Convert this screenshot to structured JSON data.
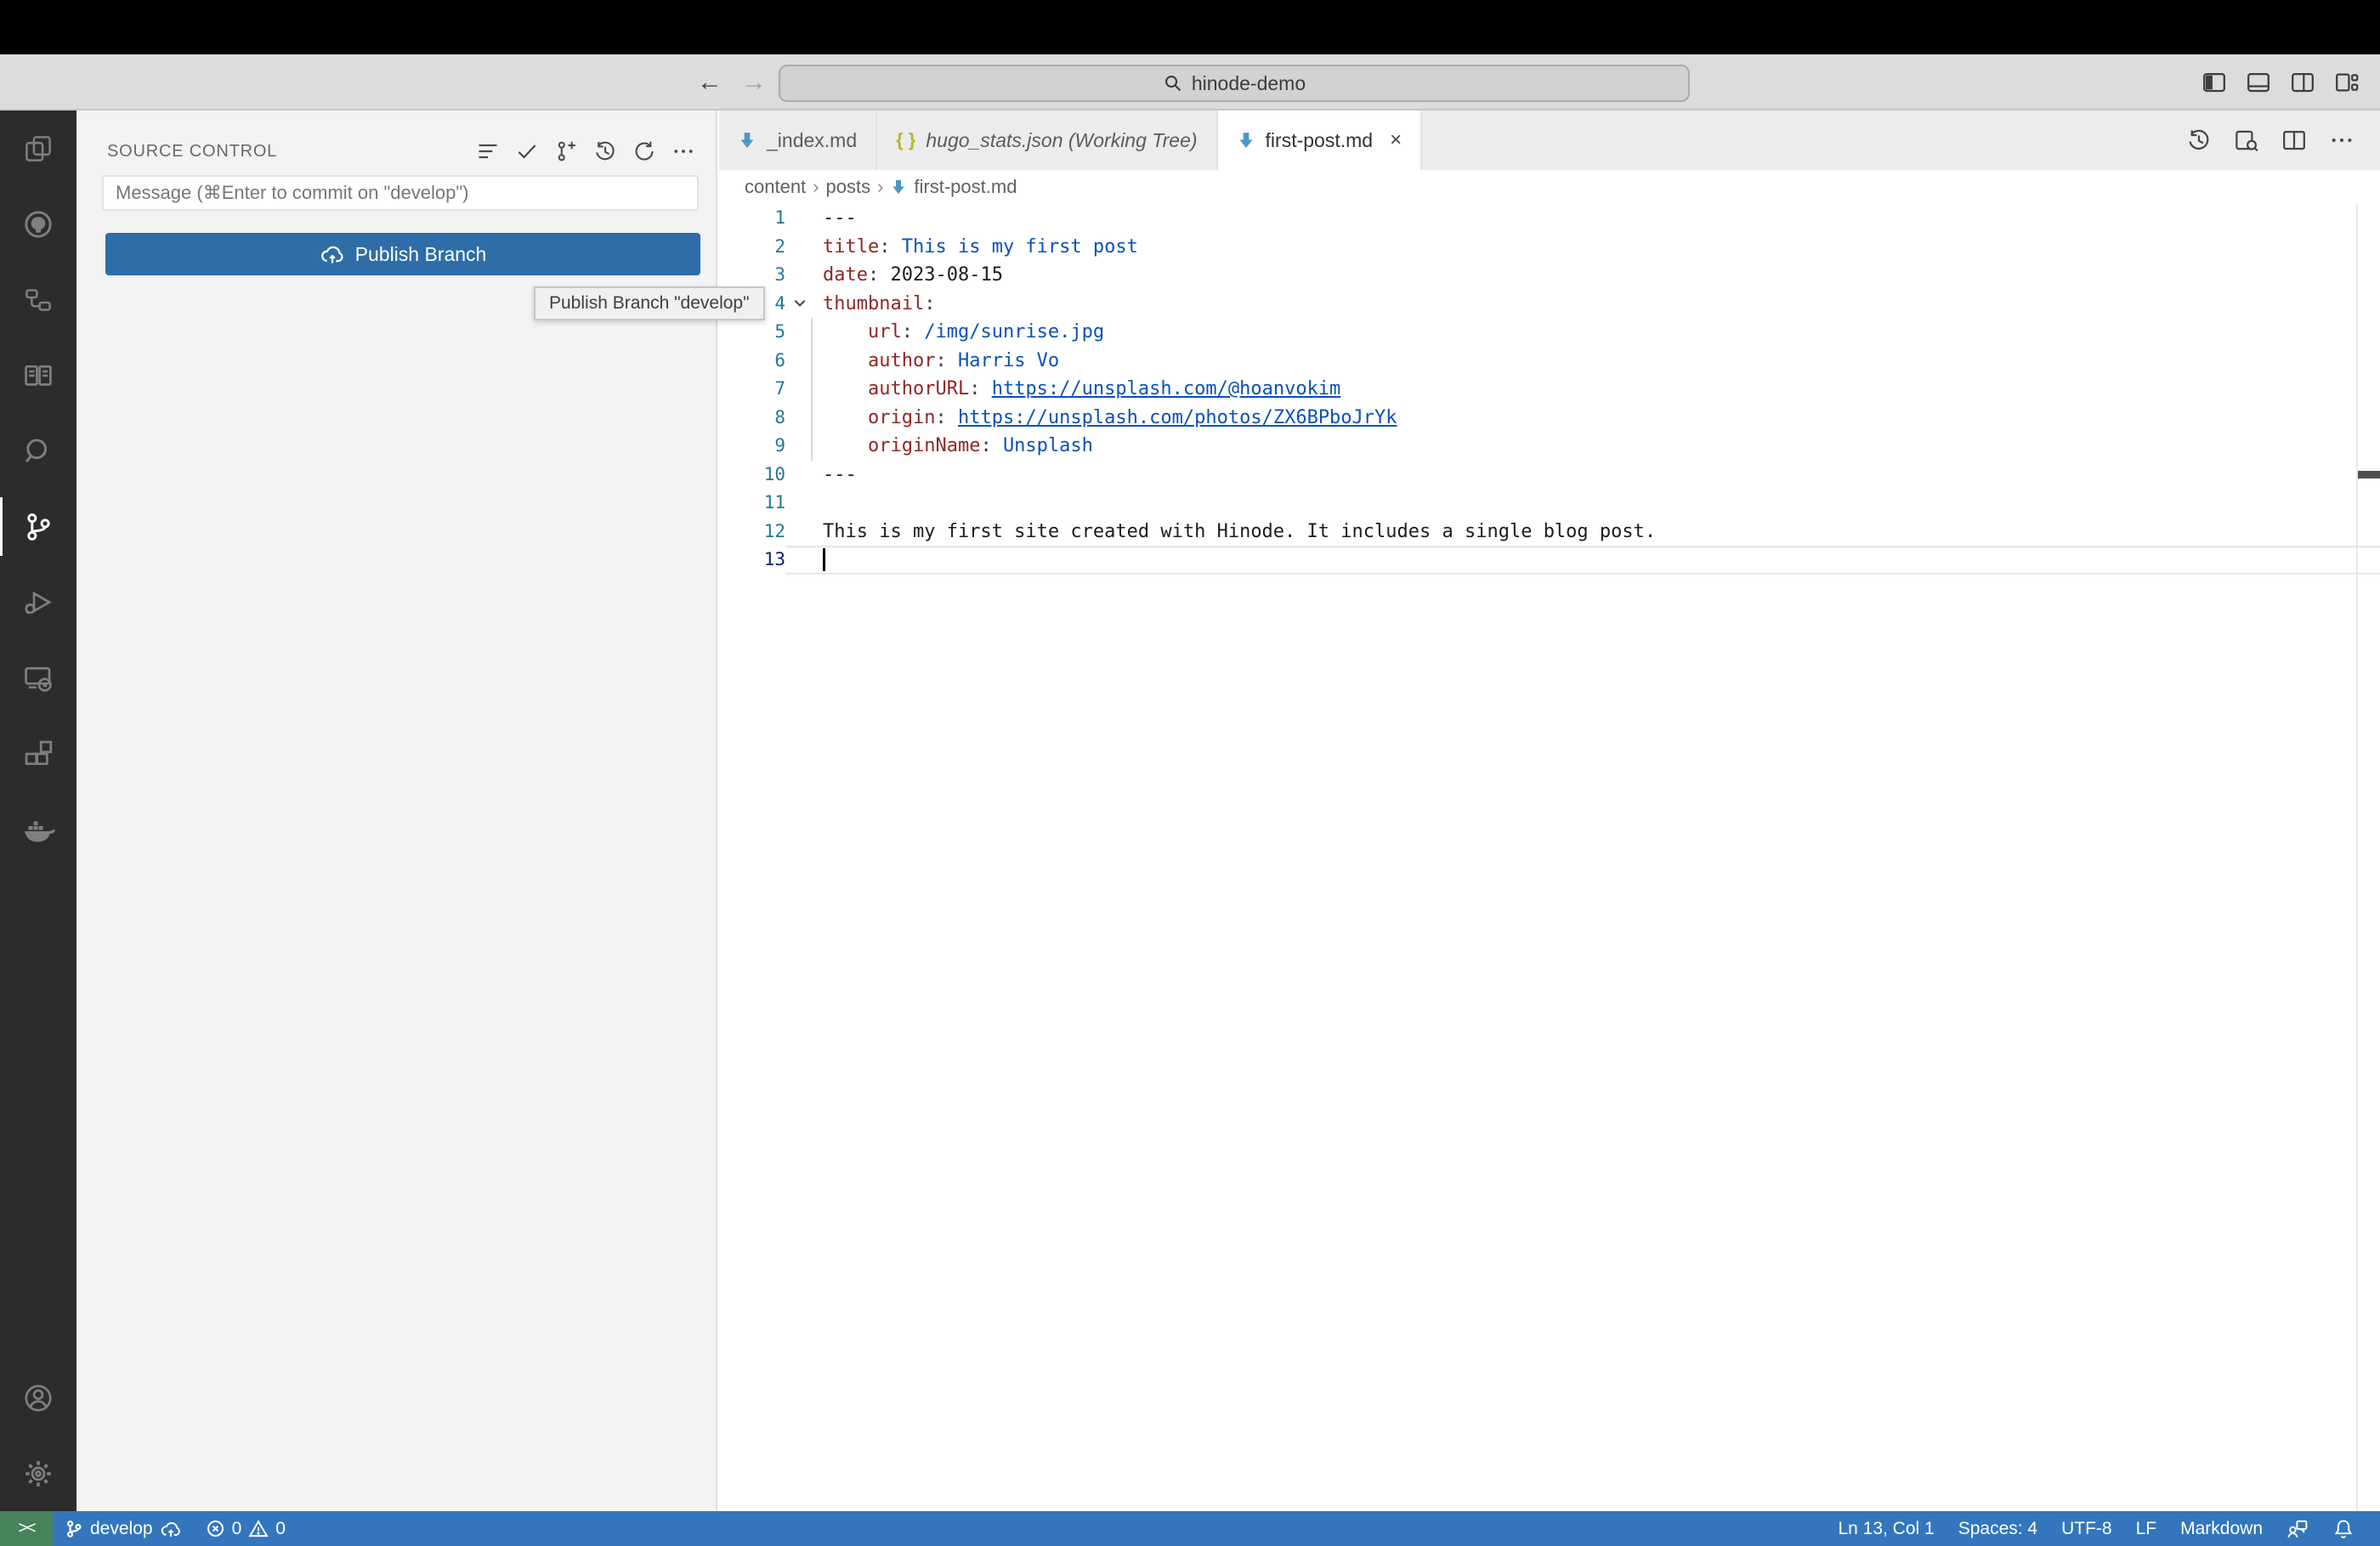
{
  "titlebar": {
    "search_value": "hinode-demo",
    "back": "←",
    "forward": "→",
    "icons": [
      "layout-sidebar-left",
      "layout-panel",
      "layout-sidebar-right",
      "layout-customize"
    ]
  },
  "activity_bar": {
    "items": [
      "explorer",
      "github",
      "hierarchy",
      "book",
      "search",
      "source-control",
      "run-debug",
      "remote-explorer",
      "extensions",
      "docker"
    ],
    "active": "source-control",
    "bottom": [
      "account",
      "settings"
    ]
  },
  "sidebar": {
    "title": "SOURCE CONTROL",
    "actions": [
      "view-as-list",
      "commit-check",
      "branch-create",
      "history",
      "refresh",
      "more-actions"
    ],
    "message_placeholder": "Message (⌘Enter to commit on \"develop\")",
    "publish_label": "Publish Branch",
    "tooltip": "Publish Branch \"develop\""
  },
  "editor": {
    "tabs": [
      {
        "label": "_index.md",
        "icon": "markdown"
      },
      {
        "label": "hugo_stats.json (Working Tree)",
        "icon": "json"
      },
      {
        "label": "first-post.md",
        "icon": "markdown",
        "close": "×"
      }
    ],
    "actions": [
      "timeline",
      "open-preview",
      "split-editor",
      "more-actions"
    ],
    "breadcrumb": {
      "items": [
        "content",
        "posts"
      ],
      "separator": "›",
      "file": "first-post.md"
    },
    "lines": [
      {
        "n": "1",
        "tokens": [
          [
            "---",
            "pln"
          ]
        ]
      },
      {
        "n": "2",
        "tokens": [
          [
            "title",
            "key"
          ],
          [
            ": ",
            "pun"
          ],
          [
            "This is my first post",
            "str"
          ]
        ]
      },
      {
        "n": "3",
        "tokens": [
          [
            "date",
            "key"
          ],
          [
            ": ",
            "pun"
          ],
          [
            "2023-08-15",
            "pln"
          ]
        ]
      },
      {
        "n": "4",
        "fold": true,
        "tokens": [
          [
            "thumbnail",
            "key"
          ],
          [
            ":",
            "pun"
          ]
        ]
      },
      {
        "n": "5",
        "guide": true,
        "tokens": [
          [
            "    ",
            "pln"
          ],
          [
            "url",
            "key"
          ],
          [
            ": ",
            "pun"
          ],
          [
            "/img/sunrise.jpg",
            "str"
          ]
        ]
      },
      {
        "n": "6",
        "guide": true,
        "tokens": [
          [
            "    ",
            "pln"
          ],
          [
            "author",
            "key"
          ],
          [
            ": ",
            "pun"
          ],
          [
            "Harris Vo",
            "str"
          ]
        ]
      },
      {
        "n": "7",
        "guide": true,
        "tokens": [
          [
            "    ",
            "pln"
          ],
          [
            "authorURL",
            "key"
          ],
          [
            ": ",
            "pun"
          ],
          [
            "https://unsplash.com/@hoanvokim",
            "lnk"
          ]
        ]
      },
      {
        "n": "8",
        "guide": true,
        "tokens": [
          [
            "    ",
            "pln"
          ],
          [
            "origin",
            "key"
          ],
          [
            ": ",
            "pun"
          ],
          [
            "https://unsplash.com/photos/ZX6BPboJrYk",
            "lnk"
          ]
        ]
      },
      {
        "n": "9",
        "guide": true,
        "tokens": [
          [
            "    ",
            "pln"
          ],
          [
            "originName",
            "key"
          ],
          [
            ": ",
            "pun"
          ],
          [
            "Unsplash",
            "str"
          ]
        ]
      },
      {
        "n": "10",
        "tokens": [
          [
            "---",
            "pln"
          ]
        ]
      },
      {
        "n": "11",
        "tokens": []
      },
      {
        "n": "12",
        "tokens": [
          [
            "This is my first site created with Hinode. It includes a single blog post.",
            "pln"
          ]
        ]
      },
      {
        "n": "13",
        "current": true,
        "cursor": true,
        "tokens": []
      }
    ]
  },
  "statusbar": {
    "remote_indicator": "><",
    "branch": "develop",
    "errors": "0",
    "warnings": "0",
    "line_col": "Ln 13, Col 1",
    "spaces": "Spaces: 4",
    "encoding": "UTF-8",
    "eol": "LF",
    "language": "Markdown"
  }
}
